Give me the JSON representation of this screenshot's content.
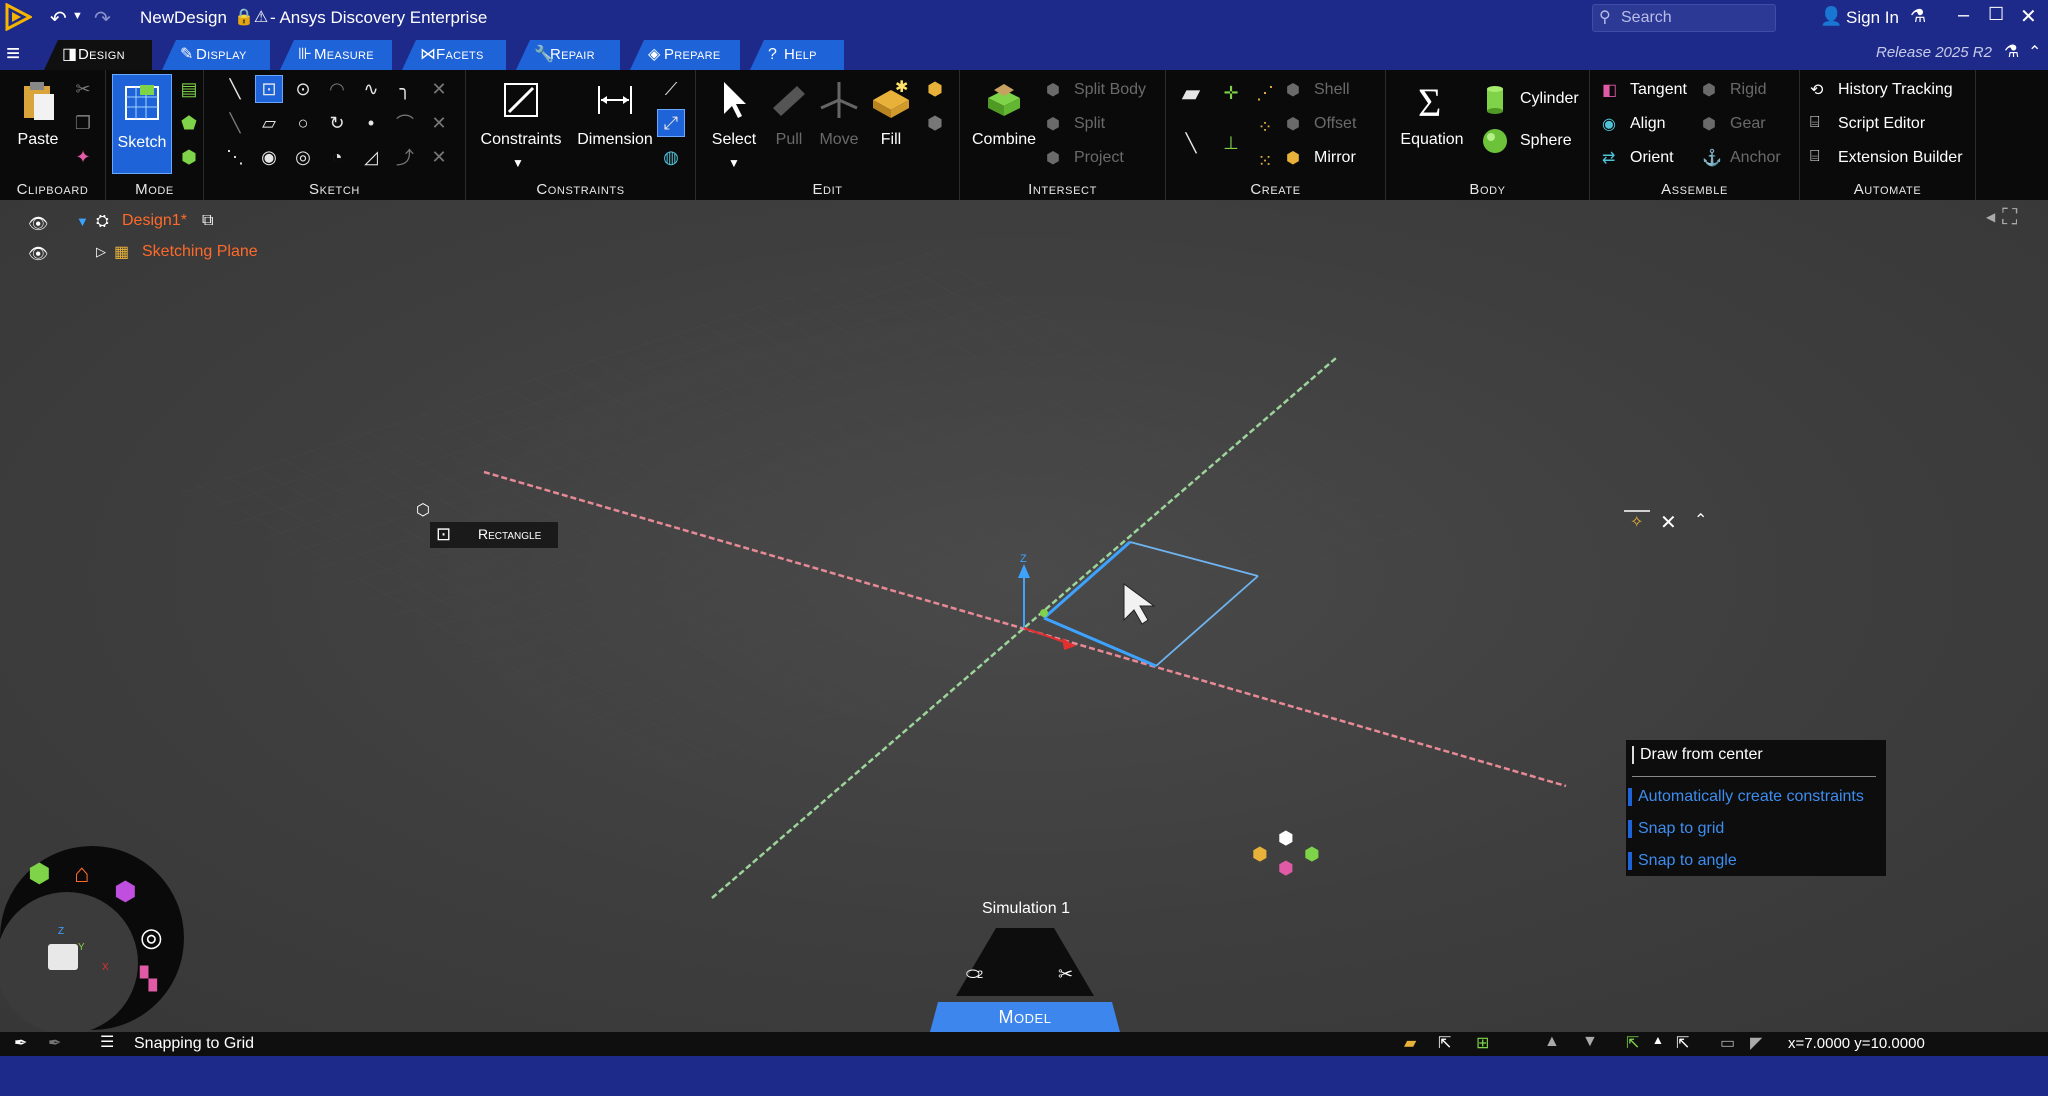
{
  "titlebar": {
    "doc_name": "NewDesign",
    "app_name": "- Ansys Discovery Enterprise",
    "search_placeholder": "Search",
    "sign_in": "Sign In"
  },
  "tabs": [
    {
      "label": "Design",
      "icon": "design-icon"
    },
    {
      "label": "Display",
      "icon": "display-icon"
    },
    {
      "label": "Measure",
      "icon": "measure-icon"
    },
    {
      "label": "Facets",
      "icon": "facets-icon"
    },
    {
      "label": "Repair",
      "icon": "repair-icon"
    },
    {
      "label": "Prepare",
      "icon": "prepare-icon"
    },
    {
      "label": "Help",
      "icon": "help-icon"
    }
  ],
  "release": "Release 2025 R2",
  "ribbon": {
    "clipboard": {
      "paste": "Paste",
      "label": "Clipboard"
    },
    "mode": {
      "sketch": "Sketch",
      "label": "Mode"
    },
    "sketch": {
      "label": "Sketch"
    },
    "constraints": {
      "constraints": "Constraints",
      "dimension": "Dimension",
      "label": "Constraints"
    },
    "edit": {
      "select": "Select",
      "pull": "Pull",
      "move": "Move",
      "fill": "Fill",
      "label": "Edit"
    },
    "intersect": {
      "combine": "Combine",
      "split_body": "Split Body",
      "split": "Split",
      "project": "Project",
      "label": "Intersect"
    },
    "create": {
      "shell": "Shell",
      "offset": "Offset",
      "mirror": "Mirror",
      "label": "Create"
    },
    "body": {
      "equation": "Equation",
      "cylinder": "Cylinder",
      "sphere": "Sphere",
      "label": "Body"
    },
    "assemble": {
      "tangent": "Tangent",
      "align": "Align",
      "orient": "Orient",
      "rigid": "Rigid",
      "gear": "Gear",
      "anchor": "Anchor",
      "label": "Assemble"
    },
    "automate": {
      "history": "History Tracking",
      "script": "Script Editor",
      "extension": "Extension Builder",
      "label": "Automate"
    }
  },
  "tree": {
    "design": "Design1*",
    "plane": "Sketching Plane"
  },
  "tool_hint": "Rectangle",
  "options_panel": {
    "draw_center": "Draw from center",
    "auto_constraints": "Automatically create constraints",
    "snap_grid": "Snap to grid",
    "snap_angle": "Snap to angle"
  },
  "simulation": {
    "name": "Simulation 1",
    "count": "2",
    "stage": "Model"
  },
  "status": {
    "message": "Snapping to Grid",
    "coords": "x=7.0000  y=10.0000"
  },
  "colors": {
    "title_bg": "#1d2a8a",
    "tab_blue": "#1f63d8",
    "tree_orange": "#ff6a2a",
    "option_blue": "#3d8df0",
    "sketch_line": "#6fb4f0"
  }
}
